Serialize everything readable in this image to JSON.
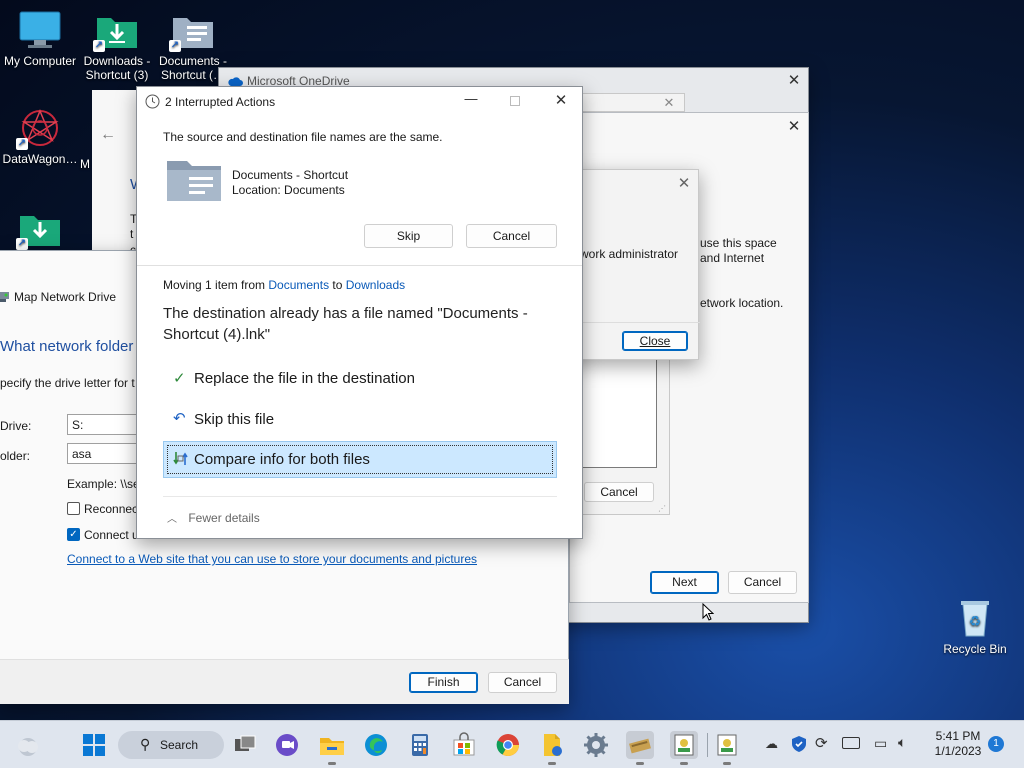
{
  "desktop": {
    "icons": [
      {
        "label": "My Computer"
      },
      {
        "label": "Downloads - Shortcut (3)"
      },
      {
        "label": "Documents - Shortcut (…"
      },
      {
        "label": "DataWagon…"
      },
      {
        "label": "M"
      },
      {
        "label": "Recycle Bin"
      }
    ]
  },
  "onedrive": {
    "title": "Microsoft OneDrive"
  },
  "map_drive": {
    "title": "Map Network Drive",
    "heading": "What network folder",
    "instruction": "pecify the drive letter for t",
    "drive_label": "Drive:",
    "drive_value": "S:",
    "folder_label": "older:",
    "folder_value": "asa",
    "example": "Example: \\\\se",
    "reconnect_label": "Reconnect",
    "connect_label": "Connect u",
    "web_link": "Connect to a Web site that you can use to store your documents and pictures",
    "finish": "Finish",
    "cancel": "Cancel"
  },
  "wizard_back": {
    "heading_frag": "W",
    "t1": "T",
    "t2": "t",
    "t3": "c",
    "next": "Next",
    "cancel": "Cancel"
  },
  "error_dialog": {
    "text1": "work administrator",
    "text2a": "use this space",
    "text2b": "and Internet",
    "text3": "etwork location.",
    "close": "Close"
  },
  "mid_dialog": {
    "cancel": "Cancel"
  },
  "interrupted": {
    "title": "2 Interrupted Actions",
    "message": "The source and destination file names are the same.",
    "file_name": "Documents - Shortcut",
    "file_location": "Location: Documents",
    "skip": "Skip",
    "cancel": "Cancel",
    "moving_prefix": "Moving 1 item from ",
    "moving_from": "Documents",
    "moving_mid": " to ",
    "moving_to": "Downloads",
    "conflict": "The destination already has a file named \"Documents - Shortcut (4).lnk\"",
    "opt_replace": "Replace the file in the destination",
    "opt_skip": "Skip this file",
    "opt_compare": "Compare info for both files",
    "fewer_details": "Fewer details"
  },
  "taskbar": {
    "search": "Search",
    "time": "5:41 PM",
    "date": "1/1/2023",
    "notification_count": "1"
  },
  "colors": {
    "accent": "#0067c0",
    "highlight": "#cce8ff",
    "check": "#2f8a3c"
  }
}
